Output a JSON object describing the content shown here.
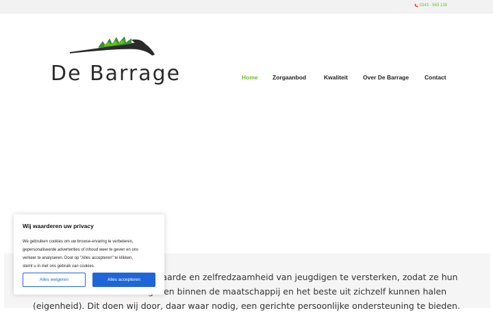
{
  "topbar": {
    "phone": "0343 - 563 133"
  },
  "logo": {
    "text": "De Barrage"
  },
  "nav": {
    "items": [
      {
        "label": "Home",
        "active": true
      },
      {
        "label": "Zorgaanbod",
        "active": false
      },
      {
        "label": "Kwaliteit",
        "active": false
      },
      {
        "label": "Over De Barrage",
        "active": false
      },
      {
        "label": "Contact",
        "active": false
      }
    ]
  },
  "mission": {
    "lines": [
      "eigenwaarde en zelfredzaamheid van jeugdigen te versterken, zodat ze hun",
      "kunnen geven binnen de maatschappij en het beste uit zichzelf kunnen halen",
      "(eigenheid). Dit doen wij door, daar waar nodig, een gerichte persoonlijke ondersteuning te bieden."
    ]
  },
  "cookie": {
    "title": "Wij waarderen uw privacy",
    "body_lines": [
      "We gebruiken cookies om uw browse-ervaring te verbeteren,",
      "gepersonaliseerde advertenties of inhoud weer te geven en ons",
      "verkeer te analyseren. Door op \"Alles accepteren\" te klikken,",
      "stemt u in met ons gebruik van cookies."
    ],
    "deny_label": "Alles weigeren",
    "accept_label": "Alles accepteren"
  },
  "colors": {
    "accent_green": "#6abf1f",
    "button_blue": "#1e66d8",
    "logo_green": "#3f8f3a"
  },
  "icons": {
    "phone": "phone-icon"
  }
}
